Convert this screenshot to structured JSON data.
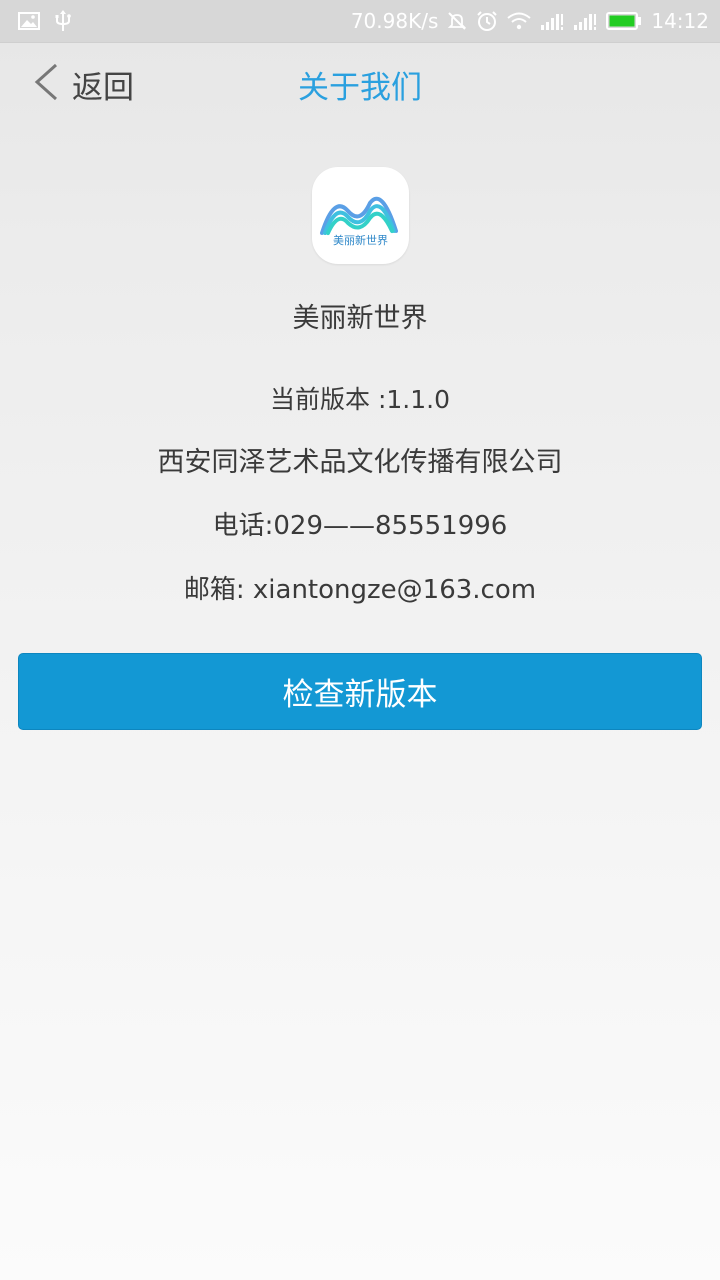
{
  "status_bar": {
    "network_speed": "70.98K/s",
    "time": "14:12",
    "icons": [
      "image-icon",
      "usb-icon",
      "mute-icon",
      "alarm-icon",
      "wifi-icon",
      "signal-icon",
      "signal-icon",
      "battery-icon"
    ],
    "battery_color": "#22cc22"
  },
  "nav": {
    "back_label": "返回",
    "title": "关于我们",
    "title_color": "#2aa0df"
  },
  "app": {
    "logo_text": "美丽新世界",
    "name": "美丽新世界",
    "version": "当前版本 :1.1.0",
    "company": "西安同泽艺术品文化传播有限公司",
    "phone": "电话:029——85551996",
    "email": "邮箱:  xiantongze@163.com"
  },
  "button": {
    "label": "检查新版本",
    "color": "#1398d4"
  }
}
